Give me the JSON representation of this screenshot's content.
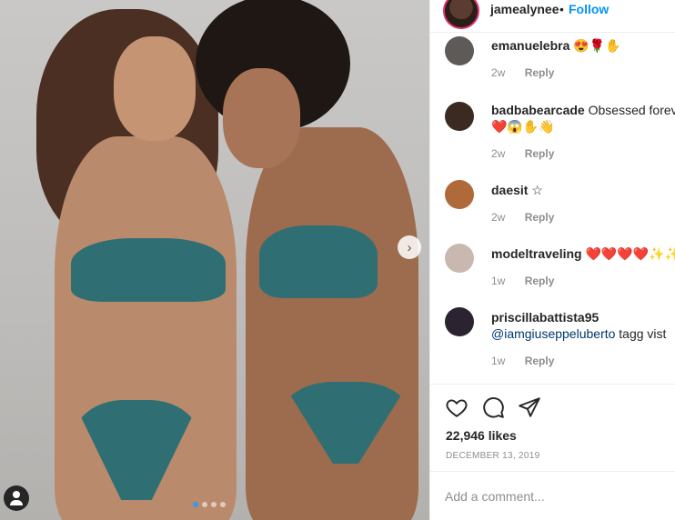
{
  "header": {
    "username": "jamealynee",
    "separator": "•",
    "follow_label": "Follow"
  },
  "carousel": {
    "next_glyph": "›",
    "slide_count": 4,
    "active_slide": 1
  },
  "comments": [
    {
      "username": "emanuelebra",
      "text": "😍🌹✋",
      "line2": "",
      "mention": "",
      "age": "2w",
      "reply_label": "Reply",
      "avatar_color": "#5d5a58"
    },
    {
      "username": "badbabearcade",
      "text": "Obsessed foreve",
      "line2": "❤️😱✋👋",
      "mention": "",
      "age": "2w",
      "reply_label": "Reply",
      "avatar_color": "#3a2a22"
    },
    {
      "username": "daesit",
      "text": "☆",
      "line2": "",
      "mention": "",
      "age": "2w",
      "reply_label": "Reply",
      "avatar_color": "#b06a3a"
    },
    {
      "username": "modeltraveling",
      "text": "❤️❤️❤️❤️✨✨✨",
      "line2": "",
      "mention": "",
      "age": "1w",
      "reply_label": "Reply",
      "avatar_color": "#c9b8b0"
    },
    {
      "username": "priscillabattista95",
      "text": "",
      "line2": "tagg vist",
      "mention": "@iamgiuseppeluberto",
      "age": "1w",
      "reply_label": "Reply",
      "avatar_color": "#2b2430"
    }
  ],
  "actions": {
    "like_icon": "heart-icon",
    "comment_icon": "comment-icon",
    "share_icon": "share-icon",
    "likes_text": "22,946 likes",
    "date_text": "DECEMBER 13, 2019"
  },
  "add_comment": {
    "placeholder": "Add a comment..."
  }
}
